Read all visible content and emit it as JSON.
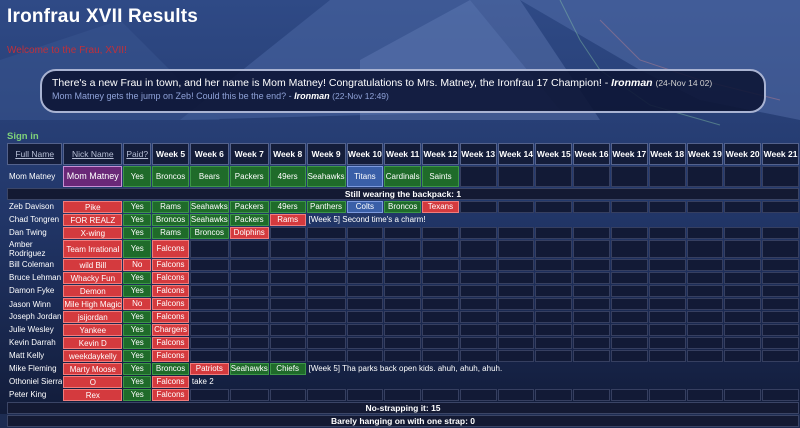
{
  "title": "Ironfrau XVII Results",
  "welcome": "Welcome to the Frau, XVII!",
  "messages": [
    {
      "text": "There's a new Frau in town, and her name is Mom Matney! Congratulations to Mrs. Matney, the Ironfrau 17 Champion! - ",
      "author": "Ironman",
      "time": "(24-Nov 14 02)"
    },
    {
      "text": "Mom Matney gets the jump on Zeb! Could this be the end? - ",
      "author": "Ironman",
      "time": "(22-Nov 12:49)"
    }
  ],
  "sign_in": "Sign in",
  "headers": {
    "full_name": "Full Name",
    "nick_name": "Nick Name",
    "paid": "Paid?",
    "weeks": [
      "Week 5",
      "Week 6",
      "Week 7",
      "Week 8",
      "Week 9",
      "Week 10",
      "Week 11",
      "Week 12",
      "Week 13",
      "Week 14",
      "Week 15",
      "Week 16",
      "Week 17",
      "Week 18",
      "Week 19",
      "Week 20",
      "Week 21"
    ]
  },
  "status_labels": {
    "backpack": "Still wearing the backpack: 1",
    "no_strap": "No-strapping it: 15",
    "one_strap": "Barely hanging on with one strap: 0"
  },
  "colors": {
    "pick_green": "#1f6b2a",
    "pick_red": "#d43a3e",
    "pick_blue": "#3a5fa8",
    "champion_purple": "#6a2878",
    "background": "#1d2c52"
  },
  "leader": {
    "full_name": "Mom Matney",
    "nick": "Mom Matney",
    "paid": "Yes",
    "picks": [
      {
        "team": "Broncos",
        "c": "g"
      },
      {
        "team": "Bears",
        "c": "g"
      },
      {
        "team": "Packers",
        "c": "g"
      },
      {
        "team": "49ers",
        "c": "g"
      },
      {
        "team": "Seahawks",
        "c": "g"
      },
      {
        "team": "Titans",
        "c": "b"
      },
      {
        "team": "Cardinals",
        "c": "g"
      },
      {
        "team": "Saints",
        "c": "g"
      }
    ],
    "comment": ""
  },
  "players": [
    {
      "full_name": "Zeb Davison",
      "nick": "Pike",
      "paid": "Yes",
      "picks": [
        {
          "team": "Rams",
          "c": "g"
        },
        {
          "team": "Seahawks",
          "c": "g"
        },
        {
          "team": "Packers",
          "c": "g"
        },
        {
          "team": "49ers",
          "c": "g"
        },
        {
          "team": "Panthers",
          "c": "g"
        },
        {
          "team": "Colts",
          "c": "b"
        },
        {
          "team": "Broncos",
          "c": "g"
        },
        {
          "team": "Texans",
          "c": "r"
        }
      ],
      "comment": ""
    },
    {
      "full_name": "Chad Tongren",
      "nick": "FOR REALZ",
      "paid": "Yes",
      "picks": [
        {
          "team": "Broncos",
          "c": "g"
        },
        {
          "team": "Seahawks",
          "c": "g"
        },
        {
          "team": "Packers",
          "c": "g"
        },
        {
          "team": "Rams",
          "c": "r"
        }
      ],
      "comment": "[Week 5] Second time's a charm!"
    },
    {
      "full_name": "Dan Twing",
      "nick": "X-wing",
      "paid": "Yes",
      "picks": [
        {
          "team": "Rams",
          "c": "g"
        },
        {
          "team": "Broncos",
          "c": "g"
        },
        {
          "team": "Dolphins",
          "c": "r"
        }
      ],
      "comment": ""
    },
    {
      "full_name": "Amber Rodriguez",
      "nick": "Team Irrational",
      "paid": "Yes",
      "two_line": true,
      "picks": [
        {
          "team": "Falcons",
          "c": "r"
        }
      ],
      "comment": ""
    },
    {
      "full_name": "Bill Coleman",
      "nick": "wild Bill",
      "paid": "No",
      "picks": [
        {
          "team": "Falcons",
          "c": "r"
        }
      ],
      "comment": ""
    },
    {
      "full_name": "Bruce Lehman",
      "nick": "Whacky Fun",
      "paid": "Yes",
      "picks": [
        {
          "team": "Falcons",
          "c": "r"
        }
      ],
      "comment": ""
    },
    {
      "full_name": "Damon Fyke",
      "nick": "Demon",
      "paid": "Yes",
      "picks": [
        {
          "team": "Falcons",
          "c": "r"
        }
      ],
      "comment": ""
    },
    {
      "full_name": "Jason Winn",
      "nick": "Mile High Magic",
      "paid": "No",
      "two_line": true,
      "picks": [
        {
          "team": "Falcons",
          "c": "r"
        }
      ],
      "comment": ""
    },
    {
      "full_name": "Joseph Jordan",
      "nick": "jsijordan",
      "paid": "Yes",
      "picks": [
        {
          "team": "Falcons",
          "c": "r"
        }
      ],
      "comment": ""
    },
    {
      "full_name": "Julie Wesley",
      "nick": "Yankee",
      "paid": "Yes",
      "picks": [
        {
          "team": "Chargers",
          "c": "r"
        }
      ],
      "comment": ""
    },
    {
      "full_name": "Kevin Darrah",
      "nick": "Kevin D",
      "paid": "Yes",
      "picks": [
        {
          "team": "Falcons",
          "c": "r"
        }
      ],
      "comment": ""
    },
    {
      "full_name": "Matt Kelly",
      "nick": "weekdaykelly",
      "paid": "Yes",
      "picks": [
        {
          "team": "Falcons",
          "c": "r"
        }
      ],
      "comment": ""
    },
    {
      "full_name": "Mike Fleming",
      "nick": "Marty Moose",
      "paid": "Yes",
      "picks": [
        {
          "team": "Broncos",
          "c": "g"
        },
        {
          "team": "Patriots",
          "c": "r"
        },
        {
          "team": "Seahawks",
          "c": "g"
        },
        {
          "team": "Chiefs",
          "c": "g"
        }
      ],
      "comment": "[Week 5] Tha parks back open kids. ahuh, ahuh, ahuh."
    },
    {
      "full_name": "Othoniel Sierra",
      "nick": "O",
      "paid": "Yes",
      "picks": [
        {
          "team": "Falcons",
          "c": "r"
        }
      ],
      "comment": "take 2"
    },
    {
      "full_name": "Peter King",
      "nick": "Rex",
      "paid": "Yes",
      "picks": [
        {
          "team": "Falcons",
          "c": "r"
        }
      ],
      "comment": ""
    }
  ]
}
